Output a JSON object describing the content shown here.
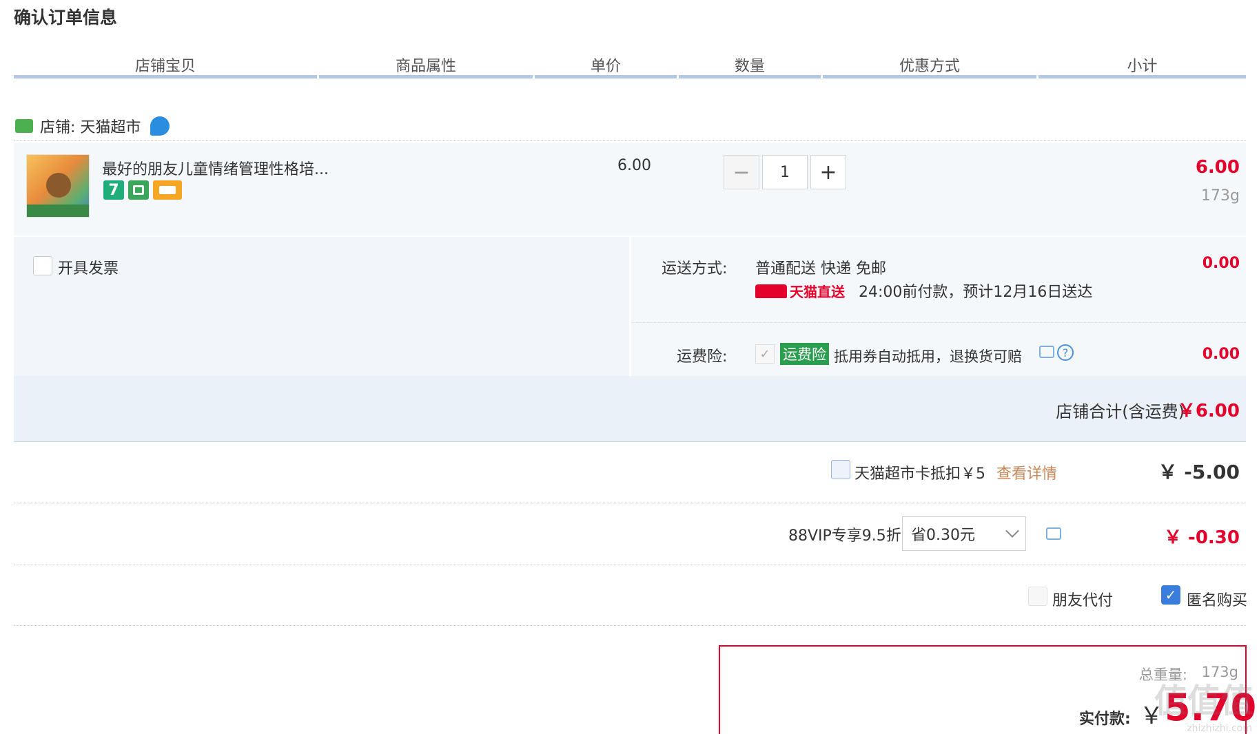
{
  "page": {
    "title": "确认订单信息"
  },
  "columns": [
    "店铺宝贝",
    "商品属性",
    "单价",
    "数量",
    "优惠方式",
    "小计"
  ],
  "store": {
    "label": "店铺: 天猫超市"
  },
  "item": {
    "name": "最好的朋友儿童情绪管理性格培...",
    "badge_seven": "7",
    "price": "6.00",
    "quantity": "1",
    "subtotal": "6.00",
    "weight": "173g"
  },
  "invoice": {
    "label": "开具发票"
  },
  "shipping": {
    "label": "运送方式:",
    "method": "普通配送 快递 免邮",
    "tmall_tag": "天猫直送",
    "eta": "24:00前付款，预计12月16日送达",
    "amount": "0.00"
  },
  "insurance": {
    "label": "运费险:",
    "badge": "运费险",
    "desc": "抵用券自动抵用，退换货可赔",
    "amount": "0.00"
  },
  "store_total": {
    "label": "店铺合计(含运费)",
    "amount": "￥6.00"
  },
  "card_discount": {
    "label": "天猫超市卡抵扣￥5",
    "link": "查看详情",
    "amount": "￥ -5.00"
  },
  "vip": {
    "label": "88VIP专享9.5折",
    "selected": "省0.30元",
    "amount": "￥ -0.30"
  },
  "options": {
    "friend_pay": "朋友代付",
    "anonymous": "匿名购买",
    "anonymous_checked": true
  },
  "summary": {
    "weight_label": "总重量:",
    "weight": "173g",
    "pay_label": "实付款:",
    "currency": "￥",
    "amount": "5.70"
  },
  "watermark": {
    "main": "值值值",
    "sub": "zhizhizhi.com"
  },
  "colors": {
    "accent_red": "#e4002b",
    "header_border": "#b3c8e6",
    "insurance_green": "#2a9d4f"
  }
}
